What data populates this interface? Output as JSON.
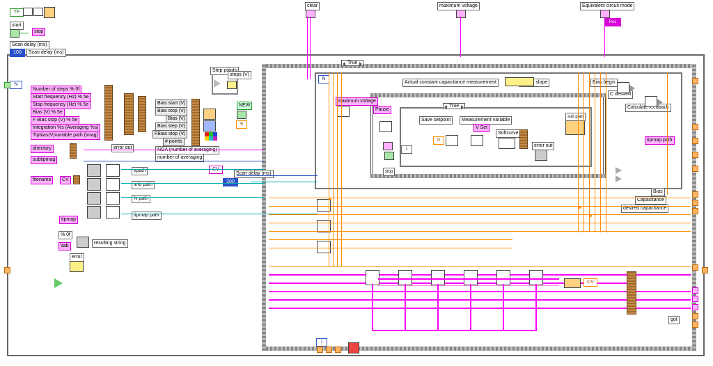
{
  "top_terminals": {
    "clear": "clear",
    "maximum_voltage": "maximum voltage",
    "equivalent_circuit_mode": "Equivalent circuit mode"
  },
  "top_left": {
    "start": "start",
    "stop": "stop",
    "scan_delay_ms": "Scan delay (ms)"
  },
  "case_selectors": {
    "outer": "True",
    "inner": "True",
    "inner2": "True"
  },
  "sections": {
    "actual_cc": "Actual constant capacitance measurement",
    "signal_slope": "Signal slope",
    "bias_begin": "Bias begin",
    "c_desired": "C desired",
    "calculate_feedback": "Calculate feedback"
  },
  "midlabels": {
    "maximum_voltage": "maximum voltage",
    "pause": "Pause",
    "save_setpoint": "Save setpoint",
    "measurement_variable": "Measurement variable",
    "v_setpoint": "V Set",
    "softcurve": "Softcurve",
    "error_out": "error out",
    "stop": "stop"
  },
  "right_outputs": {
    "bias": "Bias",
    "capacitance": "Capacitance",
    "desired_capacitance": "desired capacitance",
    "tipmap_path": "tipmap path"
  },
  "step_points": {
    "title": "Step points",
    "steps_v": "steps (V)"
  },
  "bias_params": {
    "bias_start": "Bias start (V)",
    "bias_stop": "Bias stop (V)",
    "bias": "Bias (V)",
    "bias_step": "Bias step (V)",
    "fbias_stop": "FBias stop (V)",
    "n_points": "# points"
  },
  "noa": {
    "noa": "NOA (number of averaging)",
    "numavg": "number of averaging"
  },
  "scan_delay_inner": "Scan delay (ms)",
  "left_params": {
    "numsteps": "Number of steps  % 0f",
    "startfreq": "Start frequency (Hz)  % 5e",
    "stopfreq": "Stop frequency (Hz)  % 5e",
    "bias": "Bias (V)  % 5e",
    "fbias": "F Bias stop (V)  % 5e",
    "integ": "Integration  %s (Averaging  %s)",
    "tipvol": "Tipbias(V)variable path (\\mag)"
  },
  "folders": {
    "directory": "directory",
    "subtipmag": "subtipmag"
  },
  "paths": {
    "filename": "filename",
    "vpath": "vpath",
    "info_path": "info path",
    "fv_path": "fv path",
    "tipmap_path": "tipmap path"
  },
  "small_consts": {
    "cv": "CV",
    "cv2": "CV",
    "pct0f": "% 0f",
    "tab": "\\tab",
    "loopN": "N",
    "loopi": "i",
    "error_out": "error out",
    "got": "got"
  },
  "bottom_left": {
    "resulting_string": "resulting string",
    "error": "error"
  },
  "colors": {
    "magenta": "#ff00ff",
    "orange": "#ff8c00",
    "blue": "#2850c8",
    "teal": "#0aa",
    "green": "#2a9d2a",
    "pink": "#ff90e0"
  }
}
